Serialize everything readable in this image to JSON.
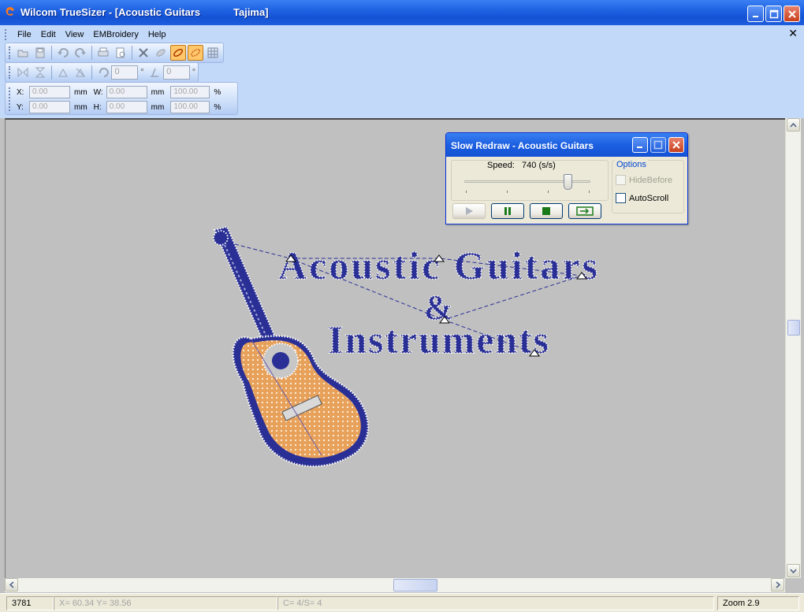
{
  "window": {
    "title": "Wilcom TrueSizer - [Acoustic Guitars",
    "title_machine": "Tajima]"
  },
  "menu": {
    "items": [
      "File",
      "Edit",
      "View",
      "EMBroidery",
      "Help"
    ]
  },
  "toolbar2": {
    "rotate_value": "0",
    "rotate_unit": "°",
    "slant_value": "0",
    "slant_unit": "°"
  },
  "coords": {
    "x_label": "X:",
    "x_value": "0.00",
    "x_unit": "mm",
    "y_label": "Y:",
    "y_value": "0.00",
    "y_unit": "mm",
    "w_label": "W:",
    "w_value": "0.00",
    "w_unit": "mm",
    "h_label": "H:",
    "h_value": "0.00",
    "h_unit": "mm",
    "w_pct": "100.00",
    "h_pct": "100.00",
    "pct_unit": "%"
  },
  "design": {
    "line1": "Acoustic Guitars",
    "line2": "&",
    "line3": "Instruments",
    "colors": {
      "thread_blue": "#2a2f96",
      "thread_orange": "#e7a15a",
      "outline_white": "#ffffff"
    }
  },
  "slow_redraw": {
    "title": "Slow Redraw - Acoustic Guitars",
    "speed_label": "Speed:",
    "speed_value": "740 (s/s)",
    "speed_fraction": 0.82,
    "options_label": "Options",
    "hide_before_label": "HideBefore",
    "hide_before_checked": false,
    "hide_before_enabled": false,
    "autoscroll_label": "AutoScroll",
    "autoscroll_checked": false
  },
  "statusbar": {
    "stitch_count": "3781",
    "position": "X= 60.34 Y= 38.56",
    "color_stop": "C= 4/S= 4",
    "zoom": "Zoom 2.9"
  }
}
